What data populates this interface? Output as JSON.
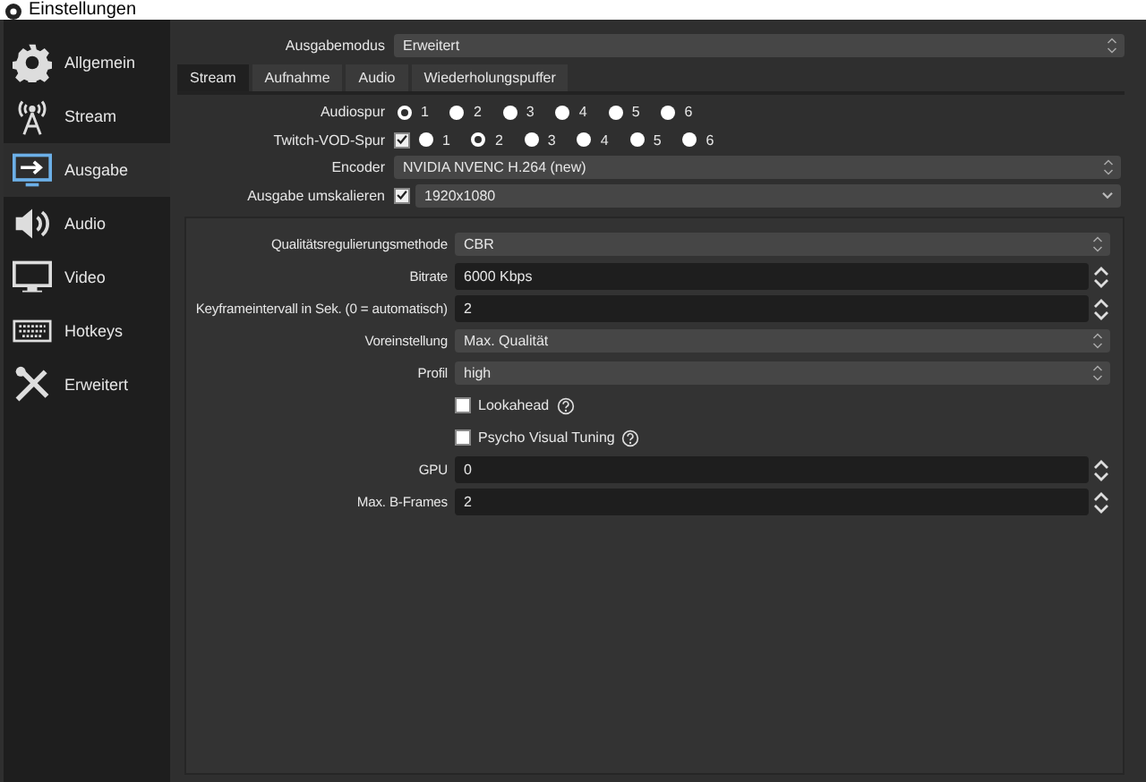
{
  "window": {
    "title": "Einstellungen"
  },
  "sidebar": {
    "items": [
      {
        "label": "Allgemein",
        "selected": false
      },
      {
        "label": "Stream",
        "selected": false
      },
      {
        "label": "Ausgabe",
        "selected": true
      },
      {
        "label": "Audio",
        "selected": false
      },
      {
        "label": "Video",
        "selected": false
      },
      {
        "label": "Hotkeys",
        "selected": false
      },
      {
        "label": "Erweitert",
        "selected": false
      }
    ]
  },
  "output_mode": {
    "label": "Ausgabemodus",
    "value": "Erweitert"
  },
  "tabs": [
    {
      "label": "Stream",
      "selected": true
    },
    {
      "label": "Aufnahme",
      "selected": false
    },
    {
      "label": "Audio",
      "selected": false
    },
    {
      "label": "Wiederholungspuffer",
      "selected": false
    }
  ],
  "stream_settings": [
    {
      "kind": "tracks",
      "label": "Audiospur",
      "tracks": [
        {
          "label": "1",
          "selected": true
        },
        {
          "label": "2",
          "selected": false
        },
        {
          "label": "3",
          "selected": false
        },
        {
          "label": "4",
          "selected": false
        },
        {
          "label": "5",
          "selected": false
        },
        {
          "label": "6",
          "selected": false
        }
      ]
    },
    {
      "kind": "tracks",
      "label": "Twitch-VOD-Spur",
      "checked": true,
      "tracks": [
        {
          "label": "1",
          "selected": false
        },
        {
          "label": "2",
          "selected": true
        },
        {
          "label": "3",
          "selected": false
        },
        {
          "label": "4",
          "selected": false
        },
        {
          "label": "5",
          "selected": false
        },
        {
          "label": "6",
          "selected": false
        }
      ]
    },
    {
      "kind": "combo",
      "label": "Encoder",
      "value": "NVIDIA NVENC H.264 (new)"
    },
    {
      "kind": "dropdown",
      "label": "Ausgabe umskalieren",
      "checked": true,
      "value": "1920x1080"
    }
  ],
  "encoder_settings": [
    {
      "kind": "combo",
      "label": "Qualitätsregulierungsmethode",
      "value": "CBR"
    },
    {
      "kind": "spin",
      "label": "Bitrate",
      "value": "6000 Kbps"
    },
    {
      "kind": "spin",
      "label": "Keyframeintervall in Sek. (0 = automatisch)",
      "value": "2"
    },
    {
      "kind": "combo",
      "label": "Voreinstellung",
      "value": "Max. Qualität"
    },
    {
      "kind": "combo",
      "label": "Profil",
      "value": "high"
    },
    {
      "kind": "checkbox",
      "label": "Lookahead",
      "checked": false
    },
    {
      "kind": "checkbox",
      "label": "Psycho Visual Tuning",
      "checked": false
    },
    {
      "kind": "spin",
      "label": "GPU",
      "value": "0"
    },
    {
      "kind": "spin",
      "label": "Max. B-Frames",
      "value": "2"
    }
  ]
}
